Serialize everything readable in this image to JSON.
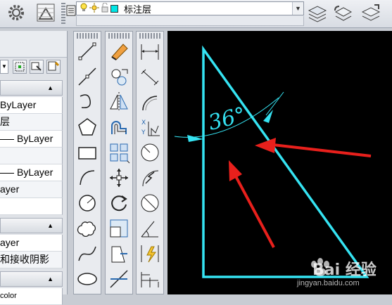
{
  "layer_combo": {
    "current_layer": "标注层",
    "color_swatch": "#00e5e5"
  },
  "properties": {
    "rows": [
      "ByLayer",
      "层",
      "ByLayer",
      "ByLayer",
      "ayer",
      "ayer",
      "和接收阴影"
    ],
    "bottom_partial": "color"
  },
  "drawing": {
    "angle_text": "36°",
    "stroke_color": "#35e3f2",
    "arrow_color": "#e8201c"
  },
  "watermark": {
    "brand": "Bai 经验",
    "url": "jingyan.baidu.com"
  }
}
